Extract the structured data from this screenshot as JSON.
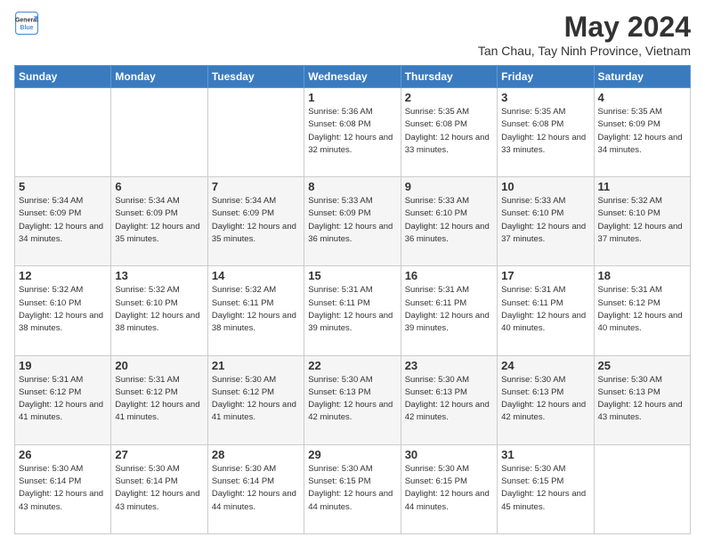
{
  "header": {
    "logo_line1": "General",
    "logo_line2": "Blue",
    "main_title": "May 2024",
    "subtitle": "Tan Chau, Tay Ninh Province, Vietnam"
  },
  "days_of_week": [
    "Sunday",
    "Monday",
    "Tuesday",
    "Wednesday",
    "Thursday",
    "Friday",
    "Saturday"
  ],
  "weeks": [
    [
      {
        "day": "",
        "info": ""
      },
      {
        "day": "",
        "info": ""
      },
      {
        "day": "",
        "info": ""
      },
      {
        "day": "1",
        "sunrise": "Sunrise: 5:36 AM",
        "sunset": "Sunset: 6:08 PM",
        "daylight": "Daylight: 12 hours and 32 minutes."
      },
      {
        "day": "2",
        "sunrise": "Sunrise: 5:35 AM",
        "sunset": "Sunset: 6:08 PM",
        "daylight": "Daylight: 12 hours and 33 minutes."
      },
      {
        "day": "3",
        "sunrise": "Sunrise: 5:35 AM",
        "sunset": "Sunset: 6:08 PM",
        "daylight": "Daylight: 12 hours and 33 minutes."
      },
      {
        "day": "4",
        "sunrise": "Sunrise: 5:35 AM",
        "sunset": "Sunset: 6:09 PM",
        "daylight": "Daylight: 12 hours and 34 minutes."
      }
    ],
    [
      {
        "day": "5",
        "sunrise": "Sunrise: 5:34 AM",
        "sunset": "Sunset: 6:09 PM",
        "daylight": "Daylight: 12 hours and 34 minutes."
      },
      {
        "day": "6",
        "sunrise": "Sunrise: 5:34 AM",
        "sunset": "Sunset: 6:09 PM",
        "daylight": "Daylight: 12 hours and 35 minutes."
      },
      {
        "day": "7",
        "sunrise": "Sunrise: 5:34 AM",
        "sunset": "Sunset: 6:09 PM",
        "daylight": "Daylight: 12 hours and 35 minutes."
      },
      {
        "day": "8",
        "sunrise": "Sunrise: 5:33 AM",
        "sunset": "Sunset: 6:09 PM",
        "daylight": "Daylight: 12 hours and 36 minutes."
      },
      {
        "day": "9",
        "sunrise": "Sunrise: 5:33 AM",
        "sunset": "Sunset: 6:10 PM",
        "daylight": "Daylight: 12 hours and 36 minutes."
      },
      {
        "day": "10",
        "sunrise": "Sunrise: 5:33 AM",
        "sunset": "Sunset: 6:10 PM",
        "daylight": "Daylight: 12 hours and 37 minutes."
      },
      {
        "day": "11",
        "sunrise": "Sunrise: 5:32 AM",
        "sunset": "Sunset: 6:10 PM",
        "daylight": "Daylight: 12 hours and 37 minutes."
      }
    ],
    [
      {
        "day": "12",
        "sunrise": "Sunrise: 5:32 AM",
        "sunset": "Sunset: 6:10 PM",
        "daylight": "Daylight: 12 hours and 38 minutes."
      },
      {
        "day": "13",
        "sunrise": "Sunrise: 5:32 AM",
        "sunset": "Sunset: 6:10 PM",
        "daylight": "Daylight: 12 hours and 38 minutes."
      },
      {
        "day": "14",
        "sunrise": "Sunrise: 5:32 AM",
        "sunset": "Sunset: 6:11 PM",
        "daylight": "Daylight: 12 hours and 38 minutes."
      },
      {
        "day": "15",
        "sunrise": "Sunrise: 5:31 AM",
        "sunset": "Sunset: 6:11 PM",
        "daylight": "Daylight: 12 hours and 39 minutes."
      },
      {
        "day": "16",
        "sunrise": "Sunrise: 5:31 AM",
        "sunset": "Sunset: 6:11 PM",
        "daylight": "Daylight: 12 hours and 39 minutes."
      },
      {
        "day": "17",
        "sunrise": "Sunrise: 5:31 AM",
        "sunset": "Sunset: 6:11 PM",
        "daylight": "Daylight: 12 hours and 40 minutes."
      },
      {
        "day": "18",
        "sunrise": "Sunrise: 5:31 AM",
        "sunset": "Sunset: 6:12 PM",
        "daylight": "Daylight: 12 hours and 40 minutes."
      }
    ],
    [
      {
        "day": "19",
        "sunrise": "Sunrise: 5:31 AM",
        "sunset": "Sunset: 6:12 PM",
        "daylight": "Daylight: 12 hours and 41 minutes."
      },
      {
        "day": "20",
        "sunrise": "Sunrise: 5:31 AM",
        "sunset": "Sunset: 6:12 PM",
        "daylight": "Daylight: 12 hours and 41 minutes."
      },
      {
        "day": "21",
        "sunrise": "Sunrise: 5:30 AM",
        "sunset": "Sunset: 6:12 PM",
        "daylight": "Daylight: 12 hours and 41 minutes."
      },
      {
        "day": "22",
        "sunrise": "Sunrise: 5:30 AM",
        "sunset": "Sunset: 6:13 PM",
        "daylight": "Daylight: 12 hours and 42 minutes."
      },
      {
        "day": "23",
        "sunrise": "Sunrise: 5:30 AM",
        "sunset": "Sunset: 6:13 PM",
        "daylight": "Daylight: 12 hours and 42 minutes."
      },
      {
        "day": "24",
        "sunrise": "Sunrise: 5:30 AM",
        "sunset": "Sunset: 6:13 PM",
        "daylight": "Daylight: 12 hours and 42 minutes."
      },
      {
        "day": "25",
        "sunrise": "Sunrise: 5:30 AM",
        "sunset": "Sunset: 6:13 PM",
        "daylight": "Daylight: 12 hours and 43 minutes."
      }
    ],
    [
      {
        "day": "26",
        "sunrise": "Sunrise: 5:30 AM",
        "sunset": "Sunset: 6:14 PM",
        "daylight": "Daylight: 12 hours and 43 minutes."
      },
      {
        "day": "27",
        "sunrise": "Sunrise: 5:30 AM",
        "sunset": "Sunset: 6:14 PM",
        "daylight": "Daylight: 12 hours and 43 minutes."
      },
      {
        "day": "28",
        "sunrise": "Sunrise: 5:30 AM",
        "sunset": "Sunset: 6:14 PM",
        "daylight": "Daylight: 12 hours and 44 minutes."
      },
      {
        "day": "29",
        "sunrise": "Sunrise: 5:30 AM",
        "sunset": "Sunset: 6:15 PM",
        "daylight": "Daylight: 12 hours and 44 minutes."
      },
      {
        "day": "30",
        "sunrise": "Sunrise: 5:30 AM",
        "sunset": "Sunset: 6:15 PM",
        "daylight": "Daylight: 12 hours and 44 minutes."
      },
      {
        "day": "31",
        "sunrise": "Sunrise: 5:30 AM",
        "sunset": "Sunset: 6:15 PM",
        "daylight": "Daylight: 12 hours and 45 minutes."
      },
      {
        "day": "",
        "info": ""
      }
    ]
  ]
}
